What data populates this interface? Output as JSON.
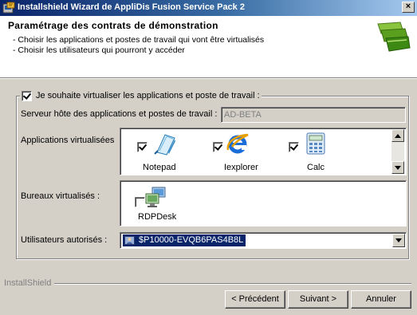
{
  "window": {
    "title": "Installshield Wizard de AppliDis Fusion Service Pack 2",
    "close_glyph": "×"
  },
  "header": {
    "title": "Paramétrage des contrats de démonstration",
    "line1": "- Choisir les applications et postes de travail qui vont être virtualisés",
    "line2": "- Choisir les utilisateurs qui pourront y accéder"
  },
  "virtualize": {
    "checked": true,
    "label": "Je souhaite virtualiser les applications et poste de travail :"
  },
  "server": {
    "label": "Serveur hôte des applications et postes de travail :",
    "value": "AD-BETA"
  },
  "applications": {
    "label": "Applications virtualisées",
    "items": [
      {
        "name": "Notepad",
        "checked": true,
        "icon": "notepad-icon"
      },
      {
        "name": "Iexplorer",
        "checked": true,
        "icon": "internet-explorer-icon"
      },
      {
        "name": "Calc",
        "checked": true,
        "icon": "calculator-icon"
      }
    ]
  },
  "desktops": {
    "label": "Bureaux virtualisés :",
    "items": [
      {
        "name": "RDPDesk",
        "checked": false,
        "icon": "remote-desktop-icon"
      }
    ]
  },
  "users": {
    "label": "Utilisateurs autorisés :",
    "selected": "$P10000-EVQB6PAS4B8L",
    "icon": "user-group-icon"
  },
  "footer": {
    "brand": "InstallShield",
    "back_label": "< Précédent",
    "next_label": "Suivant >",
    "cancel_label": "Annuler"
  },
  "colors": {
    "titlebar_start": "#0a246a",
    "titlebar_end": "#a6caf0",
    "selection": "#0a246a",
    "face": "#d4d0c8"
  }
}
